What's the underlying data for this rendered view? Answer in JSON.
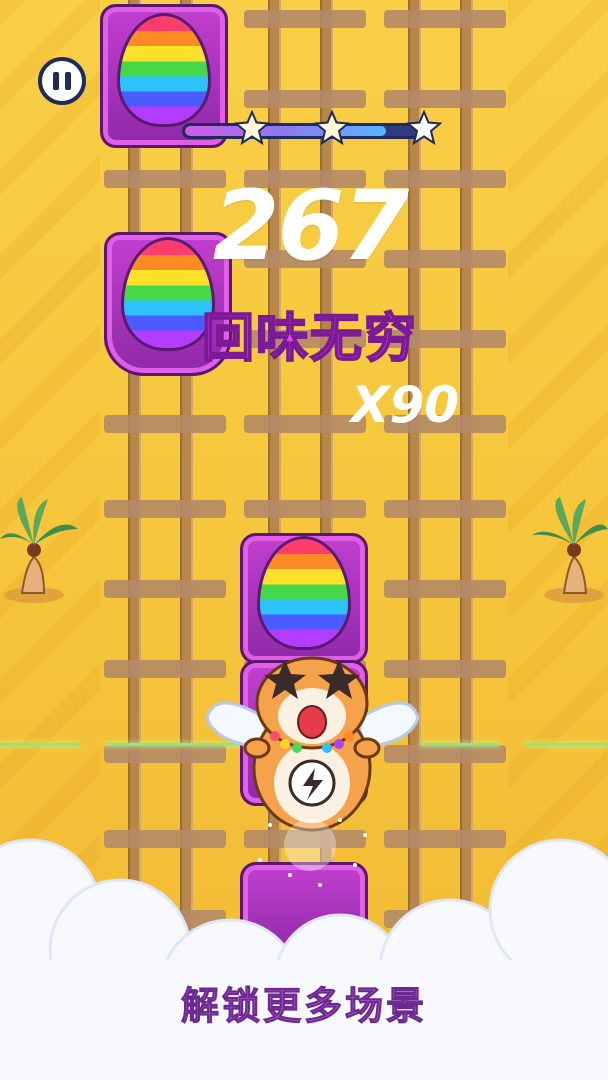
{
  "hud": {
    "score": "267",
    "combo_label": "回味无穷",
    "multiplier": "X90",
    "progress_fraction": 0.86,
    "stars_total": 3
  },
  "footer": {
    "caption": "解锁更多场景"
  },
  "colors": {
    "background": "#f6c63c",
    "train": "#c23fcf",
    "accent_text": "#e943ff",
    "progress_fill": "#8b7bf0"
  },
  "icons": {
    "pause": "pause-icon",
    "star": "star-icon",
    "egg": "rainbow-egg-icon",
    "character": "hamster-character",
    "palm": "palm-tree-icon"
  }
}
